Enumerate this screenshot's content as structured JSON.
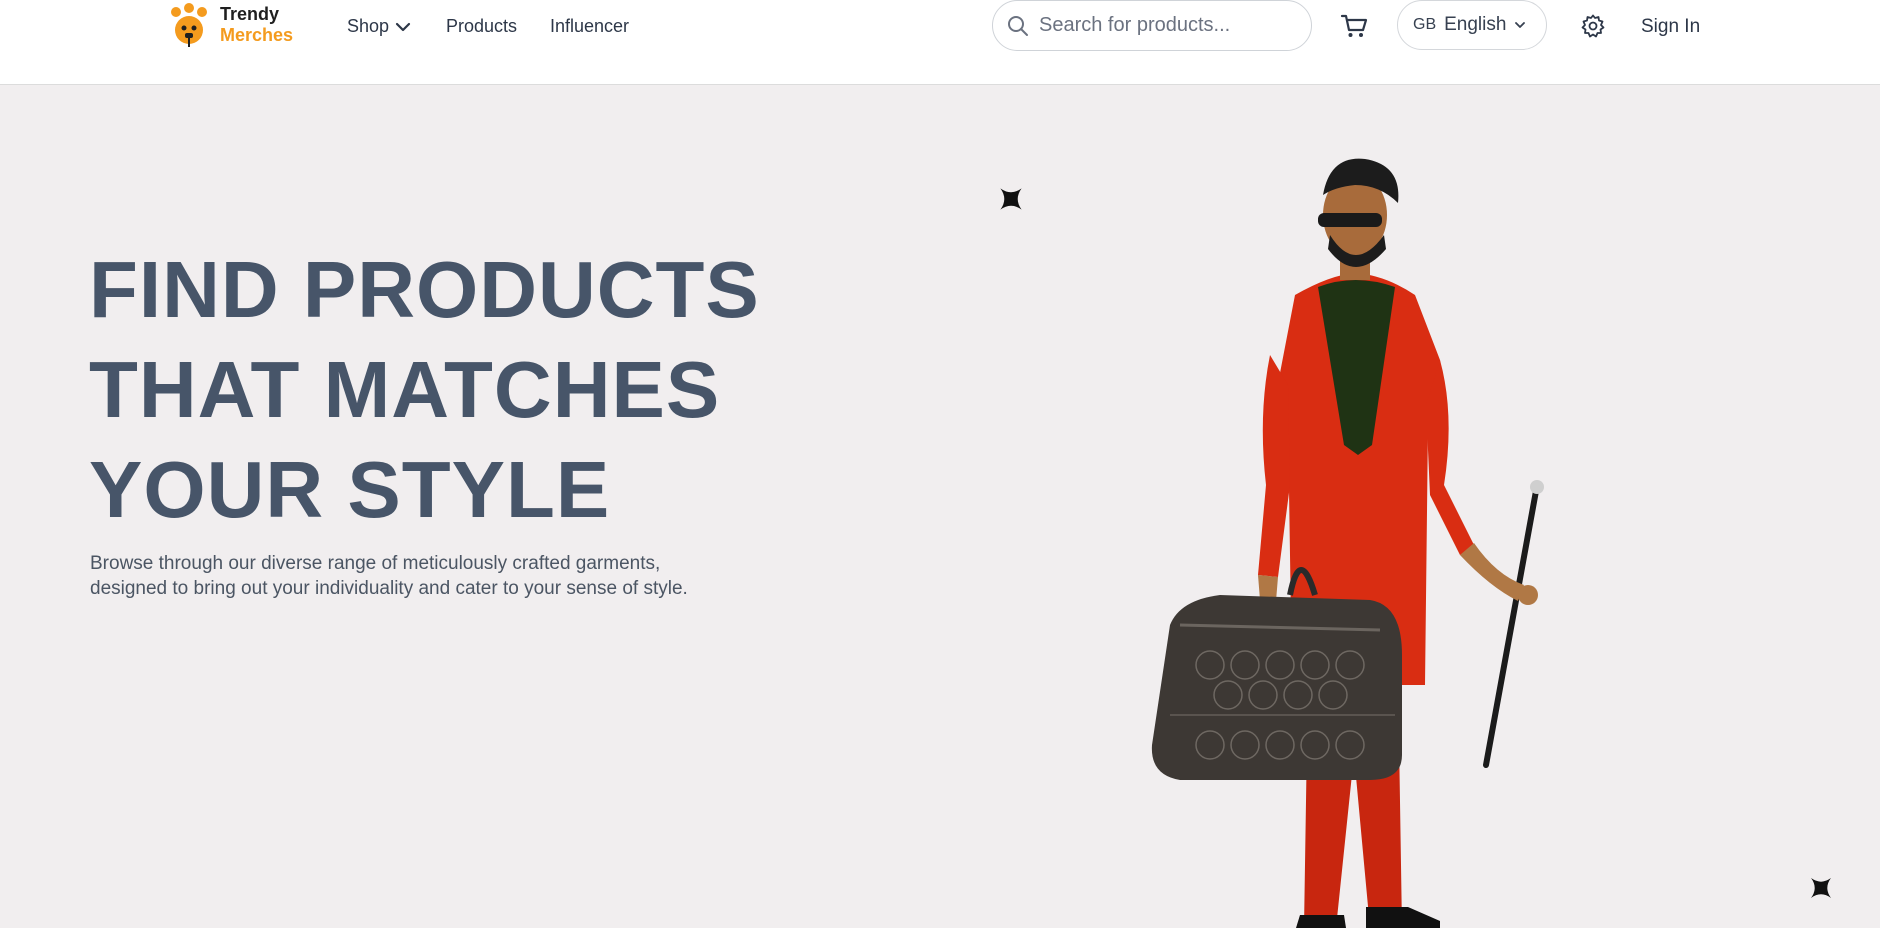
{
  "nav": {
    "logo": {
      "line1": "Trendy",
      "line2": "Merches",
      "icon": "giraffe-logo-icon"
    },
    "links": [
      {
        "label": "Shop",
        "icon": "chevron-down-icon"
      },
      {
        "label": "Products"
      },
      {
        "label": "Influencer"
      }
    ],
    "search": {
      "placeholder": "Search for products...",
      "value": "",
      "icon": "search-icon"
    },
    "cart": {
      "icon": "cart-icon"
    },
    "language": {
      "code": "GB",
      "label": "English",
      "icon": "chevron-down-icon"
    },
    "settings": {
      "icon": "gear-icon"
    },
    "sign_in_label": "Sign In"
  },
  "hero": {
    "headline": [
      "FIND PRODUCTS",
      "THAT MATCHES",
      "YOUR STYLE"
    ],
    "subtext": "Browse through our diverse range of meticulously crafted garments, designed to bring out your individuality and cater to your sense of style.",
    "image_icon": "model-figure-image"
  },
  "colors": {
    "accent": "#f49b1e",
    "headline": "#475569",
    "background": "#f1eeef",
    "outfit_red": "#d92d12"
  }
}
